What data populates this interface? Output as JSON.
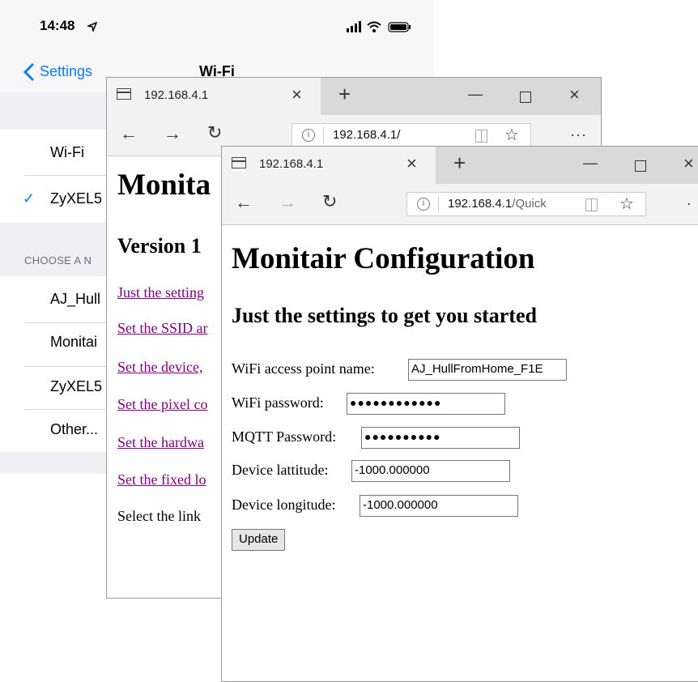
{
  "ios": {
    "time": "14:48",
    "back_label": "Settings",
    "title": "Wi-Fi",
    "wifi_row": "Wi-Fi",
    "connected_network": "ZyXEL5",
    "section_header": "CHOOSE A N",
    "networks": [
      "AJ_Hull",
      "Monitai",
      "ZyXEL5",
      "Other..."
    ]
  },
  "back_window": {
    "tab_title": "192.168.4.1",
    "url": "192.168.4.1/",
    "heading": "Monita",
    "subheading": "Version 1",
    "links": [
      "Just the setting",
      "Set the SSID ar",
      "Set the device, ",
      "Set the pixel co",
      "Set the hardwa",
      "Set the fixed lo"
    ],
    "footer_text": "Select the link"
  },
  "front_window": {
    "tab_title": "192.168.4.1",
    "url_host": "192.168.4.1",
    "url_path": "/Quick",
    "heading": "Monitair Configuration",
    "subheading": "Just the settings to get you started",
    "fields": {
      "wifi_name_label": "WiFi access point name:",
      "wifi_name_value": "AJ_HullFromHome_F1E",
      "wifi_password_label": "WiFi password:",
      "wifi_password_value": "●●●●●●●●●●●●",
      "mqtt_password_label": "MQTT Password:",
      "mqtt_password_value": "●●●●●●●●●●",
      "latitude_label": "Device lattitude:",
      "latitude_value": "-1000.000000",
      "longitude_label": "Device longitude:",
      "longitude_value": "-1000.000000"
    },
    "update_label": "Update"
  },
  "colors": {
    "ios_blue": "#0a7aff",
    "visited_link": "#800080",
    "ios_background": "#efeff4"
  }
}
